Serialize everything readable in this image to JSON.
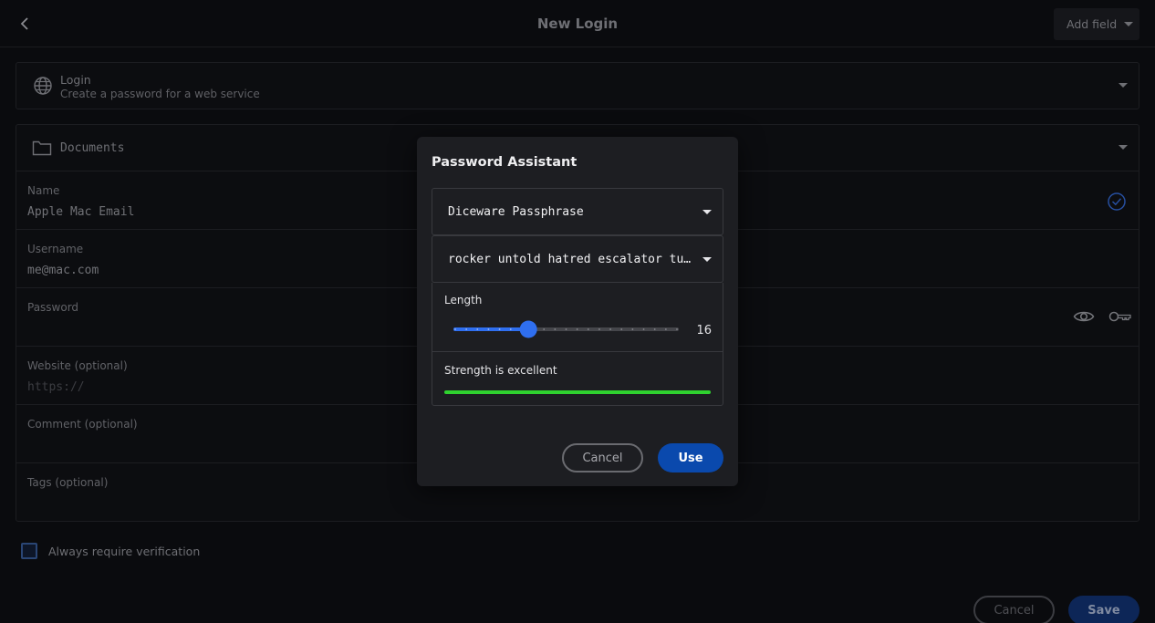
{
  "header": {
    "title": "New Login",
    "back_icon": "chevron-left-icon",
    "add_field_label": "Add field"
  },
  "item_type": {
    "title": "Login",
    "subtitle": "Create a password for a web service",
    "icon": "globe-icon"
  },
  "folder": {
    "label": "Documents",
    "icon": "folder-icon"
  },
  "fields": {
    "name": {
      "label": "Name",
      "value": "Apple Mac Email",
      "status_icon": "check-circle-icon"
    },
    "username": {
      "label": "Username",
      "value": "me@mac.com"
    },
    "password": {
      "label": "Password",
      "value": "",
      "icons": [
        "eye-icon",
        "key-icon"
      ]
    },
    "website": {
      "label": "Website (optional)",
      "placeholder": "https://"
    },
    "comment": {
      "label": "Comment (optional)"
    },
    "tags": {
      "label": "Tags (optional)"
    }
  },
  "verification": {
    "label": "Always require verification",
    "checked": false
  },
  "footer": {
    "cancel_label": "Cancel",
    "save_label": "Save"
  },
  "password_assistant": {
    "title": "Password Assistant",
    "generator_type": "Diceware Passphrase",
    "generated_passphrase": "rocker untold hatred escalator tu…",
    "length_label": "Length",
    "length_value": "16",
    "length_fraction": 0.33,
    "strength_label": "Strength is excellent",
    "strength_fraction": 1.0,
    "cancel_label": "Cancel",
    "use_label": "Use"
  },
  "colors": {
    "accent_blue": "#0a49ad",
    "slider_blue": "#2f6ff0",
    "strength_green": "#2fd22f",
    "background": "#0a0b0e",
    "modal_background": "#1d1e22"
  }
}
